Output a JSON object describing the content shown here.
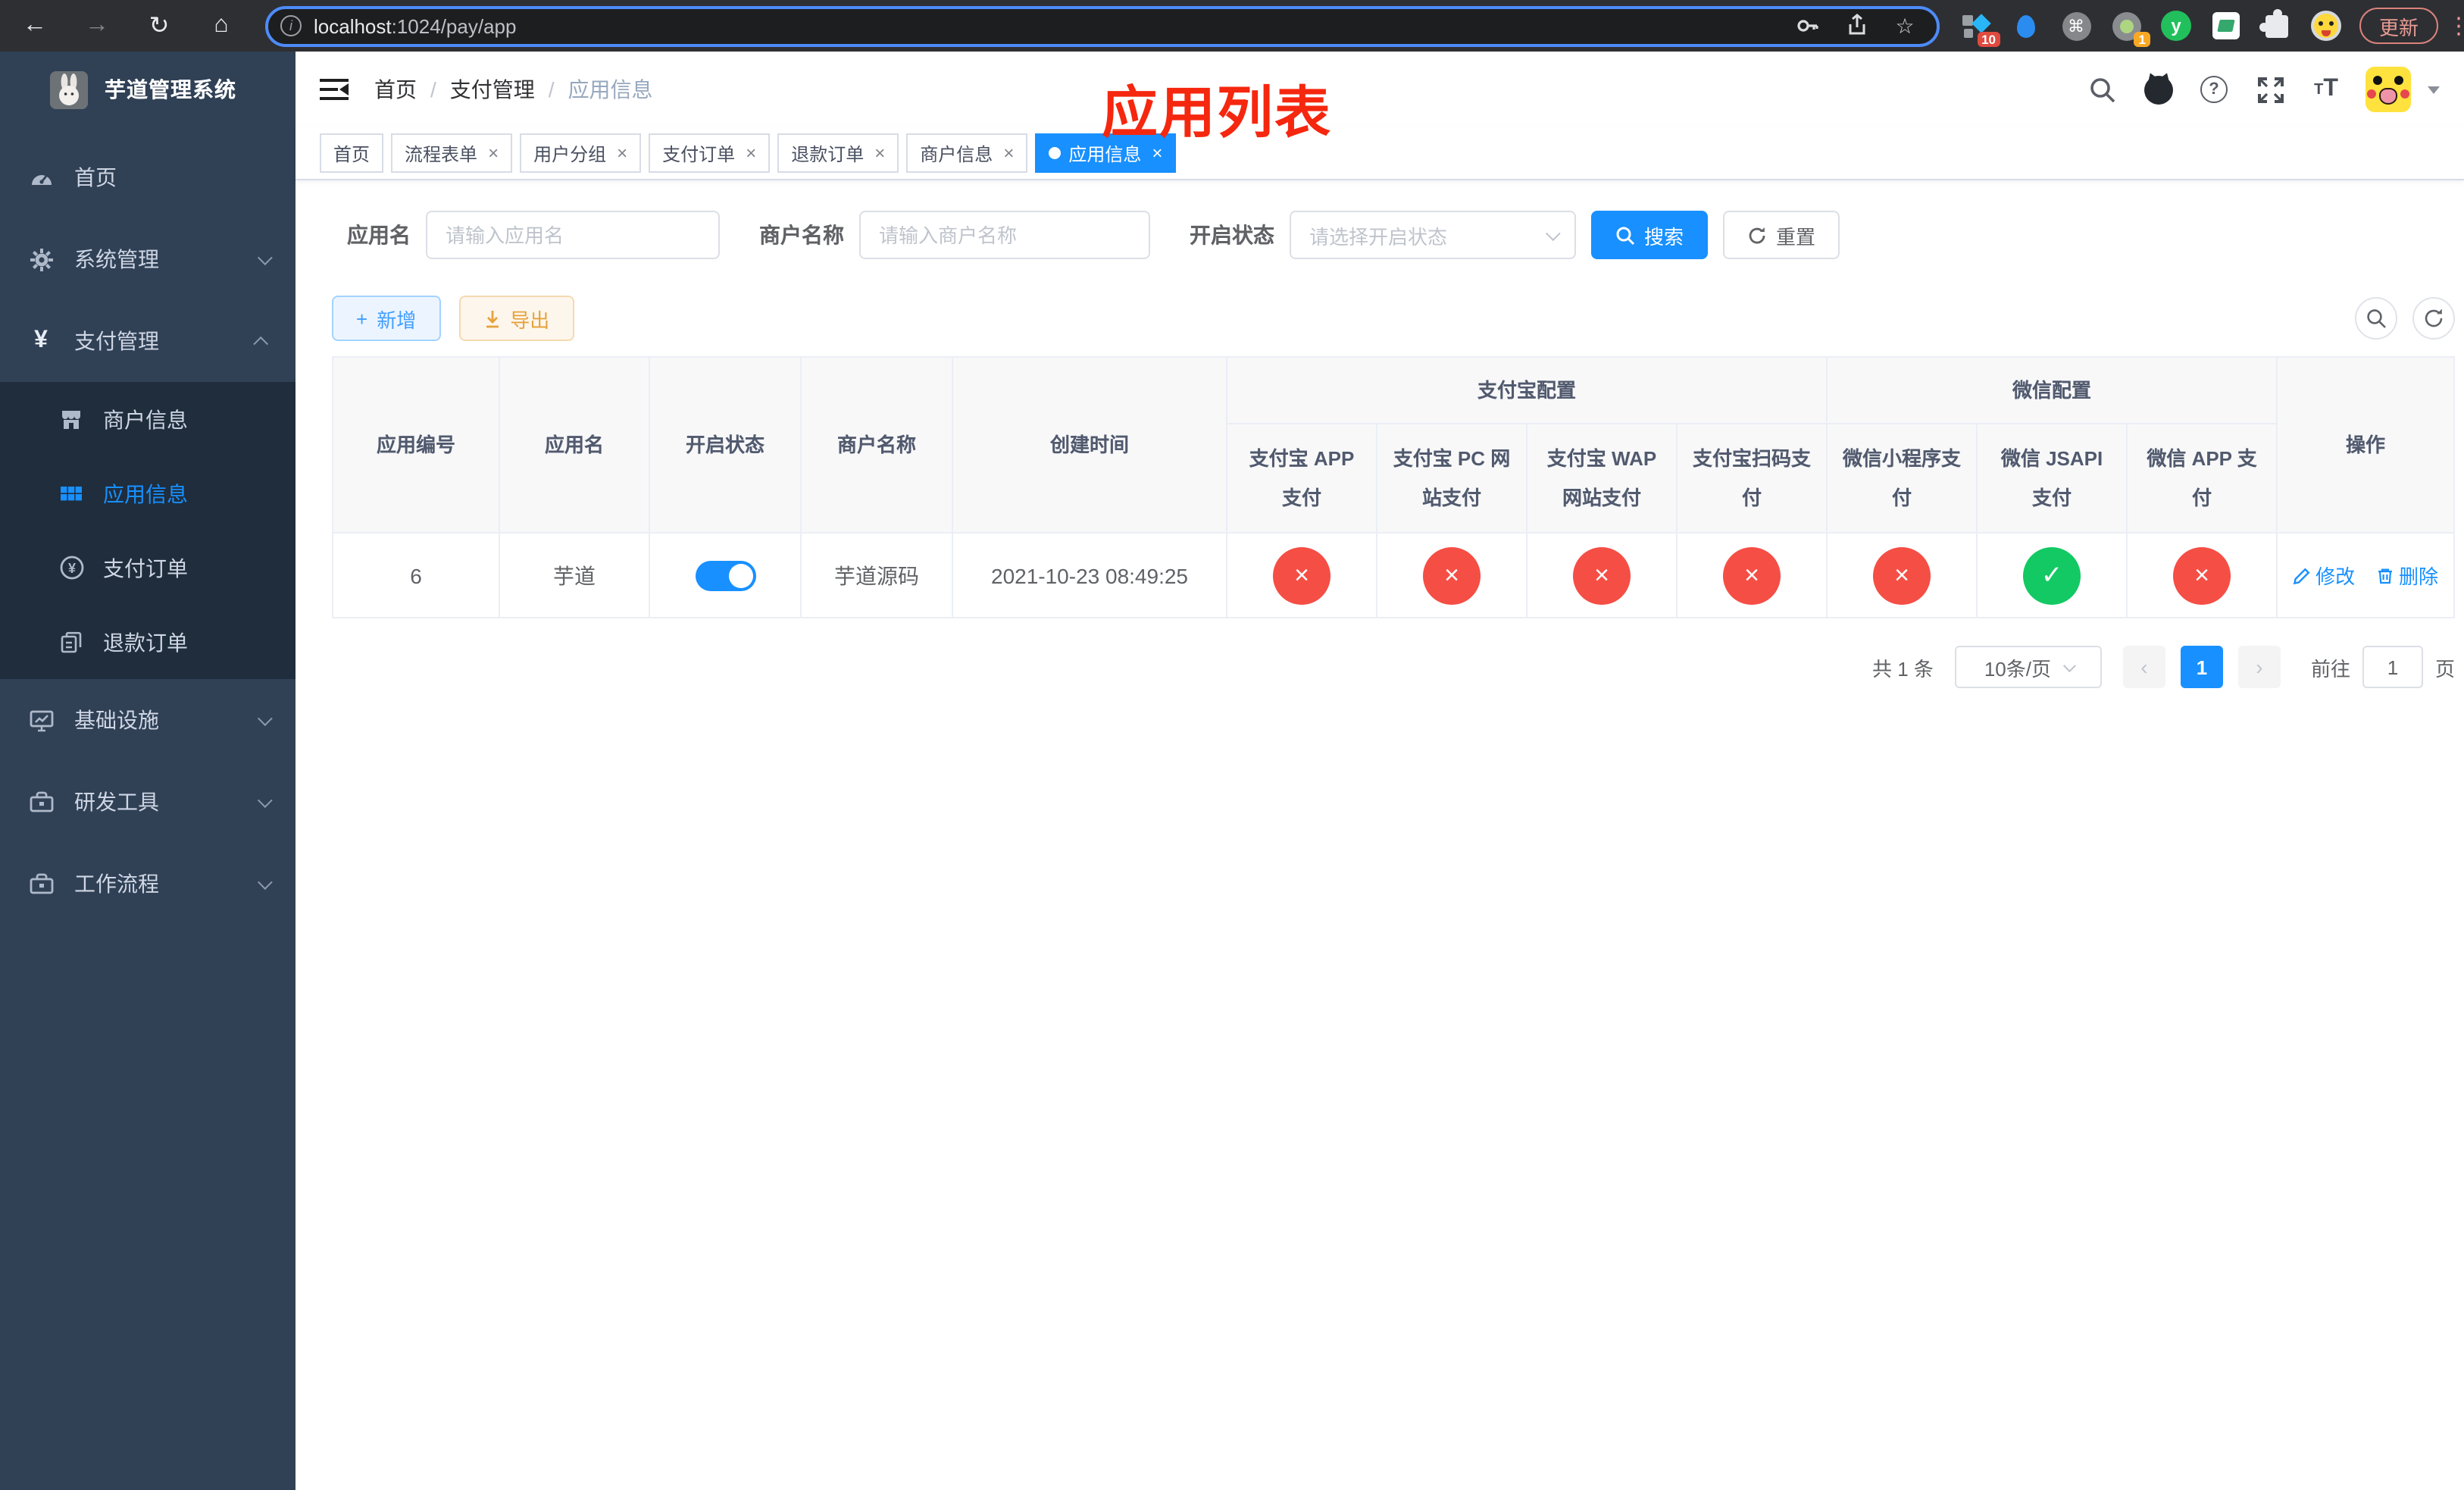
{
  "colors": {
    "accent": "#1890ff",
    "danger": "#f54e45",
    "success": "#12c964",
    "warning": "#e6a23c",
    "sidebar_bg": "#304156",
    "submenu_bg": "#1f2d3d",
    "annotation_red": "#f5270f"
  },
  "icons": {
    "check": "✓",
    "cross": "×",
    "back": "←",
    "forward": "→",
    "reload": "↻",
    "home": "⌂",
    "star": "☆",
    "kebab": "⋮",
    "cmd": "⌘",
    "info": "i",
    "help": "?",
    "plus": "+"
  },
  "browser": {
    "url_host": "localhost",
    "url_rest": ":1024/pay/app",
    "update_label": "更新",
    "ext_badge_diamond": "10",
    "ext_badge_target": "1",
    "ext_y_label": "y"
  },
  "sidebar": {
    "title": "芋道管理系统",
    "items": [
      {
        "label": "首页"
      },
      {
        "label": "系统管理"
      },
      {
        "label": "支付管理"
      },
      {
        "label": "商户信息"
      },
      {
        "label": "应用信息"
      },
      {
        "label": "支付订单"
      },
      {
        "label": "退款订单"
      },
      {
        "label": "基础设施"
      },
      {
        "label": "研发工具"
      },
      {
        "label": "工作流程"
      }
    ]
  },
  "header": {
    "breadcrumb": [
      "首页",
      "支付管理",
      "应用信息"
    ],
    "separator": "/",
    "font_small": "T",
    "font_big": "T"
  },
  "annotation": "应用列表",
  "tags": [
    {
      "label": "首页"
    },
    {
      "label": "流程表单"
    },
    {
      "label": "用户分组"
    },
    {
      "label": "支付订单"
    },
    {
      "label": "退款订单"
    },
    {
      "label": "商户信息"
    },
    {
      "label": "应用信息"
    }
  ],
  "filters": {
    "app_name_label": "应用名",
    "app_name_placeholder": "请输入应用名",
    "merchant_label": "商户名称",
    "merchant_placeholder": "请输入商户名称",
    "status_label": "开启状态",
    "status_placeholder": "请选择开启状态",
    "search_label": "搜索",
    "reset_label": "重置"
  },
  "toolbar": {
    "add_label": "新增",
    "export_label": "导出"
  },
  "table": {
    "cols": [
      "应用编号",
      "应用名",
      "开启状态",
      "商户名称",
      "创建时间"
    ],
    "groups": [
      "支付宝配置",
      "微信配置"
    ],
    "subcols": [
      "支付宝 APP 支付",
      "支付宝 PC 网站支付",
      "支付宝 WAP 网站支付",
      "支付宝扫码支付",
      "微信小程序支付",
      "微信 JSAPI 支付",
      "微信 APP 支付"
    ],
    "ops_label": "操作",
    "row": {
      "id": "6",
      "name": "芋道",
      "enabled": true,
      "merchant": "芋道源码",
      "created": "2021-10-23 08:49:25",
      "statuses": [
        "error",
        "error",
        "error",
        "error",
        "error",
        "success",
        "error"
      ],
      "edit_label": "修改",
      "delete_label": "删除"
    }
  },
  "pagination": {
    "total": "共 1 条",
    "page_size": "10条/页",
    "prev": "‹",
    "next": "›",
    "page": "1",
    "goto_prefix": "前往",
    "goto_value": "1",
    "goto_suffix": "页"
  }
}
